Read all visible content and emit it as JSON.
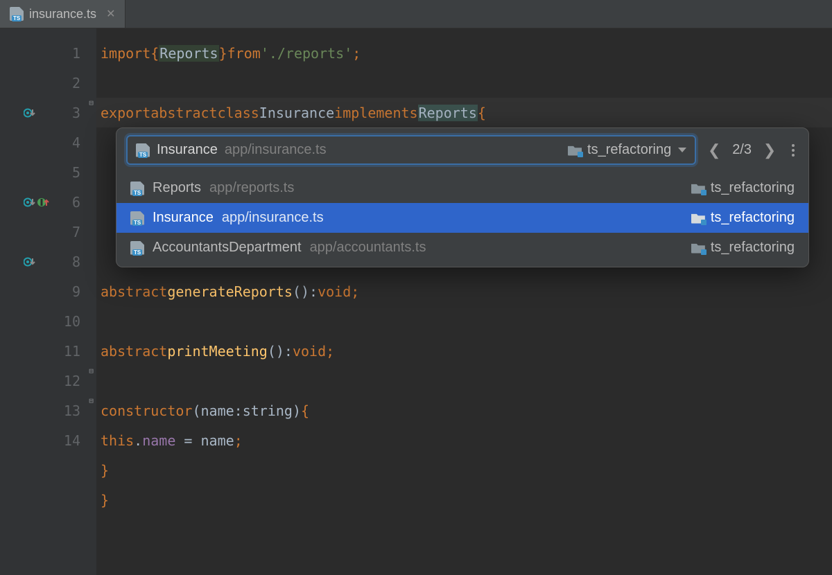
{
  "tab": {
    "filename": "insurance.ts"
  },
  "gutter": {
    "lines": [
      "1",
      "2",
      "3",
      "4",
      "5",
      "6",
      "7",
      "8",
      "9",
      "10",
      "11",
      "12",
      "13",
      "14"
    ]
  },
  "code": {
    "l1": {
      "import": "import",
      "open": "{",
      "Reports": "Reports",
      "close": "}",
      "from": "from",
      "path": "'./reports'",
      "semi": ";"
    },
    "l3": {
      "export": "export",
      "abstract": "abstract",
      "class": "class",
      "Insurance": "Insurance",
      "implements": "implements",
      "Reports": "Reports",
      "brace": "{"
    },
    "l10": {
      "abstract": "abstract",
      "fn": "generateReports",
      "parens": "()",
      "colon": ":",
      "void": "void",
      "semi": ";"
    },
    "l12": {
      "abstract": "abstract",
      "fn": "printMeeting",
      "parens": "()",
      "colon": ":",
      "void": "void",
      "semi": ";"
    },
    "l14c": {
      "ctor": "constructor",
      "open": "(",
      "param": "name",
      "colon": ":",
      "type": "string",
      "close": ")",
      "brace": "{"
    },
    "l15": {
      "this": "this",
      "dot": ".",
      "field": "name",
      "eq": " = ",
      "rhs": "name",
      "semi": ";"
    },
    "l16": {
      "brace": "}"
    },
    "l17": {
      "brace": "}"
    }
  },
  "popup": {
    "scope": {
      "name": "Insurance",
      "path": "app/insurance.ts",
      "folder": "ts_refactoring"
    },
    "counter": "2/3",
    "rows": [
      {
        "name": "Reports",
        "path": "app/reports.ts",
        "folder": "ts_refactoring",
        "selected": false
      },
      {
        "name": "Insurance",
        "path": "app/insurance.ts",
        "folder": "ts_refactoring",
        "selected": true
      },
      {
        "name": "AccountantsDepartment",
        "path": "app/accountants.ts",
        "folder": "ts_refactoring",
        "selected": false
      }
    ]
  }
}
